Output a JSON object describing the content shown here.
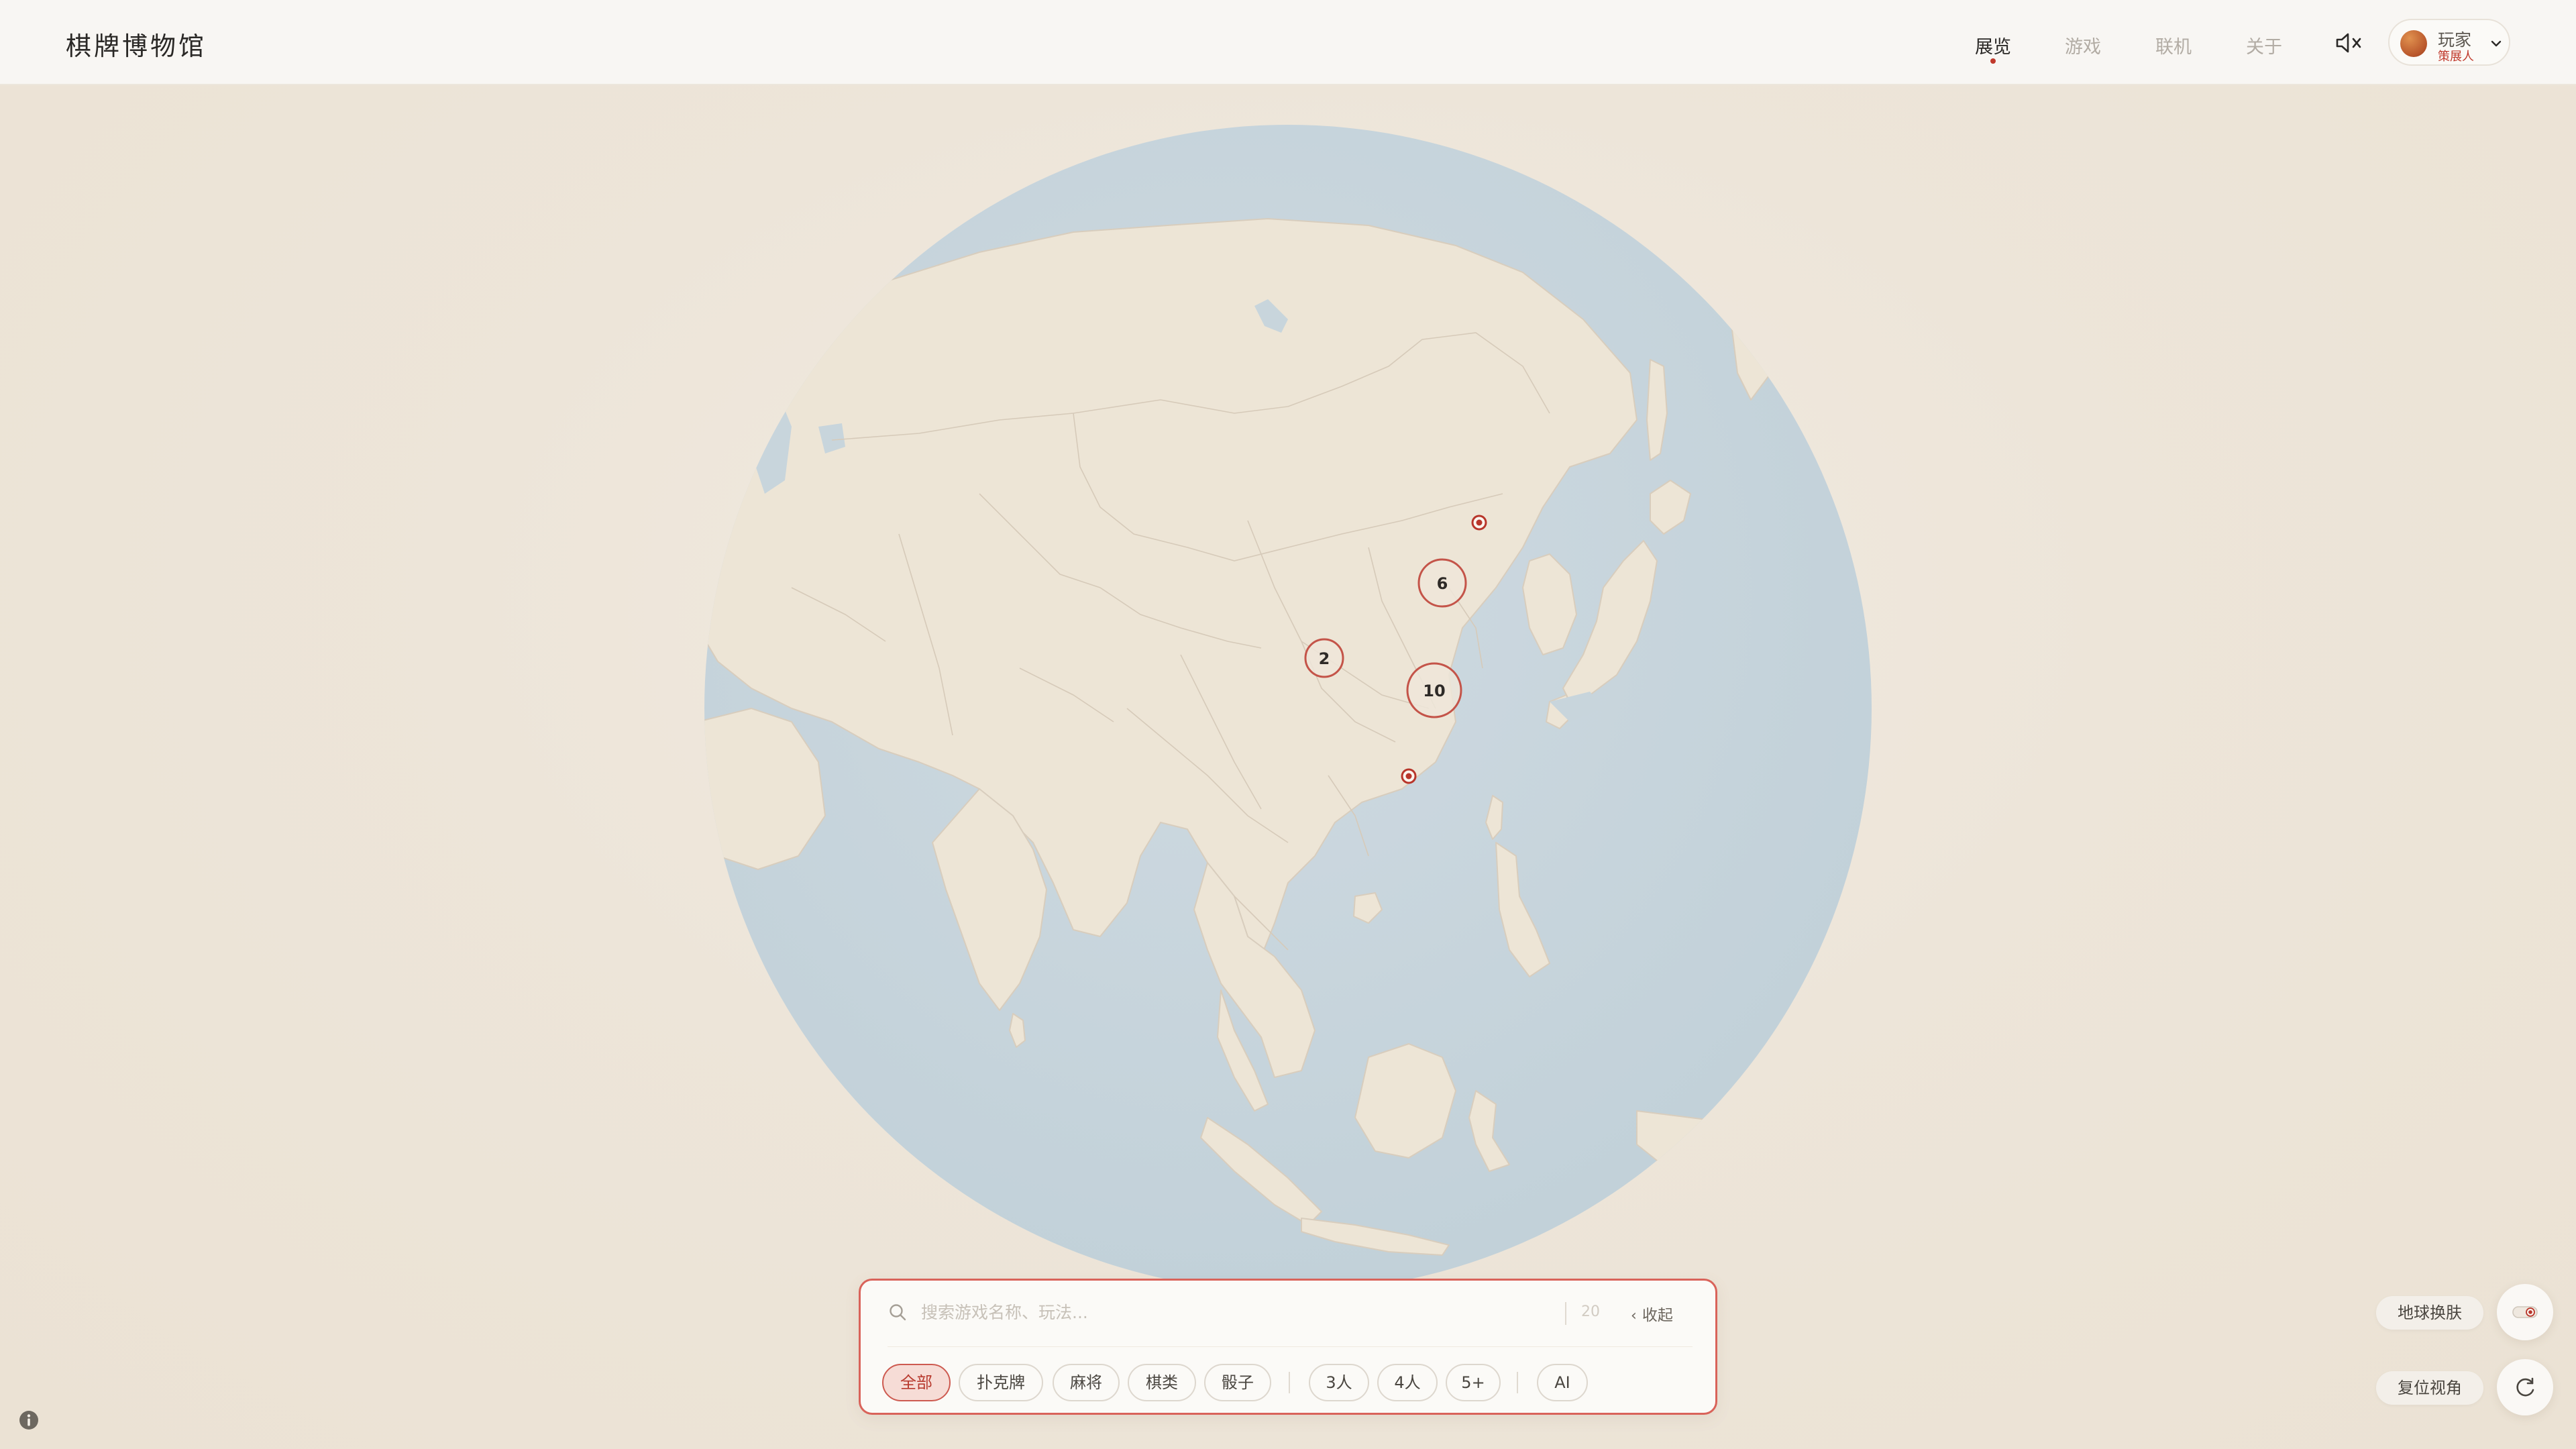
{
  "app": {
    "title": "棋牌博物馆"
  },
  "nav": {
    "items": [
      {
        "label": "展览",
        "active": true
      },
      {
        "label": "游戏",
        "active": false
      },
      {
        "label": "联机",
        "active": false
      },
      {
        "label": "关于",
        "active": false
      }
    ]
  },
  "user": {
    "name": "玩家",
    "role": "策展人"
  },
  "map": {
    "clusters": [
      {
        "count": "6"
      },
      {
        "count": "2"
      },
      {
        "count": "10"
      }
    ],
    "single_markers": 2
  },
  "search": {
    "placeholder": "搜索游戏名称、玩法...",
    "count": "20",
    "collapse_label": "收起"
  },
  "filters": {
    "categories": [
      "全部",
      "扑克牌",
      "麻将",
      "棋类",
      "骰子"
    ],
    "players": [
      "3人",
      "4人",
      "5+"
    ],
    "modes": [
      "AI"
    ],
    "active": "全部"
  },
  "controls": {
    "skin_label": "地球换肤",
    "reset_label": "复位视角"
  },
  "colors": {
    "accent": "#c0392b",
    "ocean": "#c8d5dc",
    "land": "#ede5d6",
    "background": "#ede6da"
  }
}
